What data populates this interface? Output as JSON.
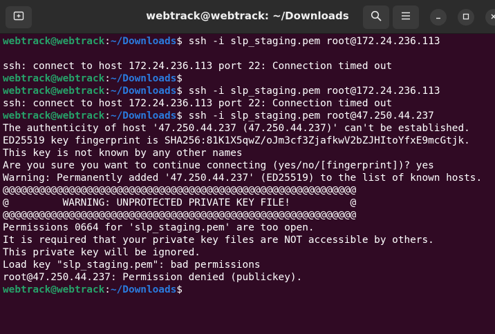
{
  "window": {
    "title": "webtrack@webtrack: ~/Downloads"
  },
  "icons": {
    "new_tab": "new-tab-icon",
    "search": "search-icon",
    "menu": "hamburger-menu-icon",
    "minimize": "minimize-icon",
    "maximize": "maximize-icon",
    "close": "close-icon"
  },
  "colors": {
    "background": "#300a24",
    "prompt_user": "#26a269",
    "prompt_path": "#2a7bde",
    "text": "#ffffff"
  },
  "prompt": {
    "user": "webtrack@webtrack",
    "sep": ":",
    "path": "~/Downloads",
    "symbol": "$"
  },
  "terminal": {
    "lines": [
      {
        "type": "prompt",
        "cmd": " ssh -i slp_staging.pem root@172.24.236.113"
      },
      {
        "type": "out",
        "text": ""
      },
      {
        "type": "out",
        "text": "ssh: connect to host 172.24.236.113 port 22: Connection timed out"
      },
      {
        "type": "prompt",
        "cmd": ""
      },
      {
        "type": "prompt",
        "cmd": " ssh -i slp_staging.pem root@172.24.236.113"
      },
      {
        "type": "out",
        "text": "ssh: connect to host 172.24.236.113 port 22: Connection timed out"
      },
      {
        "type": "prompt",
        "cmd": " ssh -i slp_staging.pem root@47.250.44.237"
      },
      {
        "type": "out",
        "text": "The authenticity of host '47.250.44.237 (47.250.44.237)' can't be established."
      },
      {
        "type": "out",
        "text": "ED25519 key fingerprint is SHA256:81K1X5qwZ/oJm3cf3ZjafkwV2bZJHItoYfxE9mcGtjk."
      },
      {
        "type": "out",
        "text": "This key is not known by any other names"
      },
      {
        "type": "out",
        "text": "Are you sure you want to continue connecting (yes/no/[fingerprint])? yes"
      },
      {
        "type": "out",
        "text": "Warning: Permanently added '47.250.44.237' (ED25519) to the list of known hosts."
      },
      {
        "type": "out",
        "text": "@@@@@@@@@@@@@@@@@@@@@@@@@@@@@@@@@@@@@@@@@@@@@@@@@@@@@@@@@@@"
      },
      {
        "type": "out",
        "text": "@         WARNING: UNPROTECTED PRIVATE KEY FILE!          @"
      },
      {
        "type": "out",
        "text": "@@@@@@@@@@@@@@@@@@@@@@@@@@@@@@@@@@@@@@@@@@@@@@@@@@@@@@@@@@@"
      },
      {
        "type": "out",
        "text": "Permissions 0664 for 'slp_staging.pem' are too open."
      },
      {
        "type": "out",
        "text": "It is required that your private key files are NOT accessible by others."
      },
      {
        "type": "out",
        "text": "This private key will be ignored."
      },
      {
        "type": "out",
        "text": "Load key \"slp_staging.pem\": bad permissions"
      },
      {
        "type": "out",
        "text": "root@47.250.44.237: Permission denied (publickey)."
      },
      {
        "type": "prompt",
        "cmd": ""
      }
    ]
  }
}
